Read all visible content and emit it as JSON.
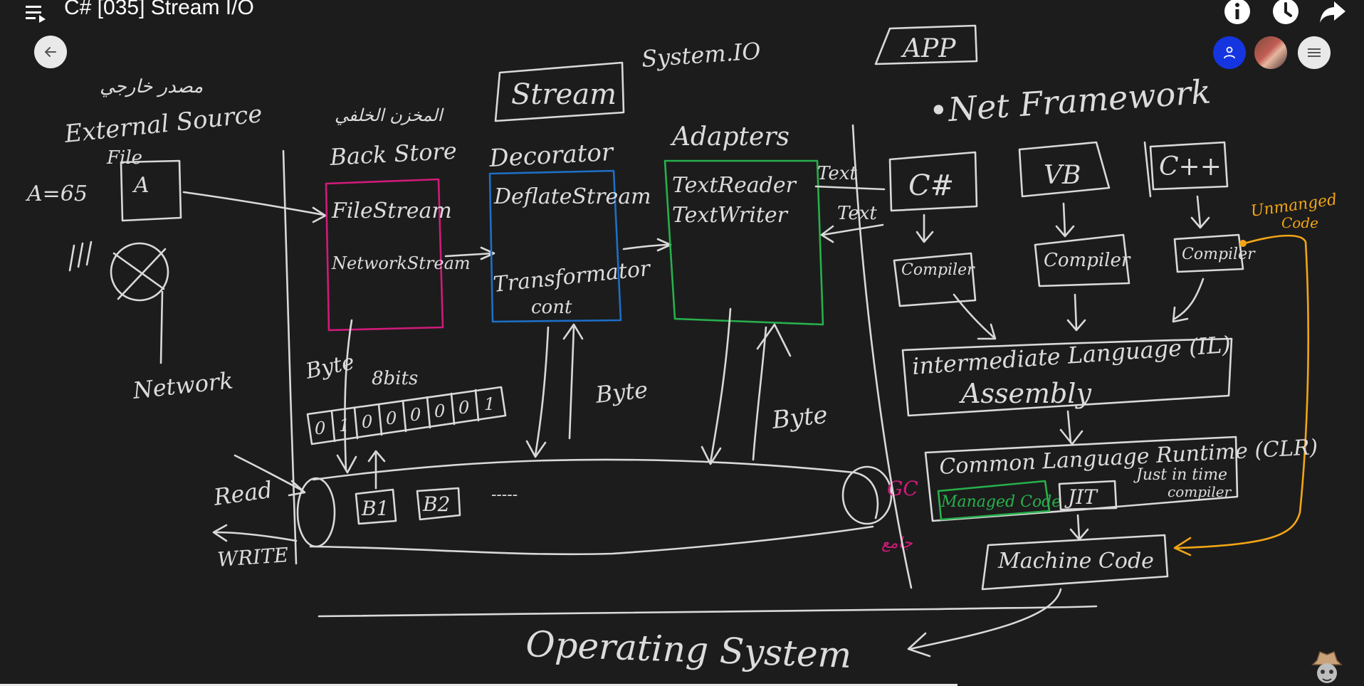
{
  "header": {
    "title": "C# [035] Stream I/O",
    "icons": [
      "menu-icon",
      "info-icon",
      "clock-icon",
      "share-arrow-icon"
    ]
  },
  "controls": {
    "back": "arrow-left-icon",
    "share_user": "person-add-icon",
    "more": "menu-icon"
  },
  "colors": {
    "board": "#1c1c1c",
    "chalk": "#d9d9d9",
    "pink": "#d11a7a",
    "blue": "#1d6fc7",
    "green": "#27b04c",
    "orange": "#f2a516",
    "share_button": "#1535e0"
  },
  "board": {
    "system_io": "System.IO",
    "stream": "Stream",
    "app": "APP",
    "net_framework": "•Net Framework",
    "arabic_external": "مصدر خارجي",
    "external_source": "External Source",
    "file": "File",
    "a_eq": "A=65",
    "a": "A",
    "network": "Network",
    "arabic_backstore": "المخزن الخلفي",
    "back_store": "Back Store",
    "filestream": "FileStream",
    "networkstream": "NetworkStream",
    "decorator": "Decorator",
    "deflatestream": "DeflateStream",
    "transformator1": "Transformator",
    "transformator2": "cont",
    "adapters": "Adapters",
    "textreader": "TextReader",
    "textwriter": "TextWriter",
    "text1": "Text",
    "text2": "Text",
    "byte1": "Byte",
    "byte2": "Byte",
    "byte3": "Byte",
    "eight_bits": "8bits",
    "bits": [
      "0",
      "1",
      "0",
      "0",
      "0",
      "0",
      "0",
      "1"
    ],
    "b1": "B1",
    "b2": "B2",
    "dots": "-----",
    "read": "Read",
    "write": "WRITE",
    "gc": "GC",
    "arabic_gc": "جامع",
    "csharp": "C#",
    "vb": "VB",
    "cpp": "C++",
    "compiler1": "Compiler",
    "compiler2": "Compiler",
    "compiler3": "Compiler",
    "unmanaged1": "Unmanged",
    "unmanaged2": "Code",
    "il": "intermediate Language (IL)",
    "assembly": "Assembly",
    "clr": "Common Language Runtime (CLR)",
    "managed_code": "Managed Code",
    "jit": "JIT",
    "jit_desc1": "Just in time",
    "jit_desc2": "compiler",
    "machine_code": "Machine Code",
    "operating_system": "Operating System"
  }
}
